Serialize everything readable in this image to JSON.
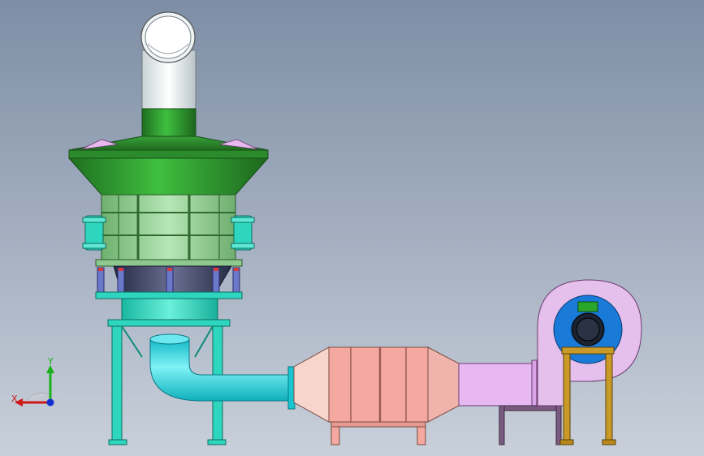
{
  "viewport": {
    "background_top": "#7e8ea5",
    "background_bottom": "#c9d0da"
  },
  "triad": {
    "x_label": "X",
    "y_label": "Y",
    "x_color": "#d01818",
    "y_color": "#18b018",
    "z_color": "#1030d0"
  },
  "parts": {
    "stack_pipe_color": "#e8eef0",
    "hood_color": "#2e8b2e",
    "scrubber_panel_color": "#8fce8f",
    "support_frame_color": "#2fd6bf",
    "duct_color": "#1ed8e0",
    "filter_box_color": "#f4a8a0",
    "fan_duct_color": "#e7b8f2",
    "fan_housing_color": "#e6c0ec",
    "motor_color": "#1a7ad8",
    "fan_stand_color": "#c99a28"
  }
}
